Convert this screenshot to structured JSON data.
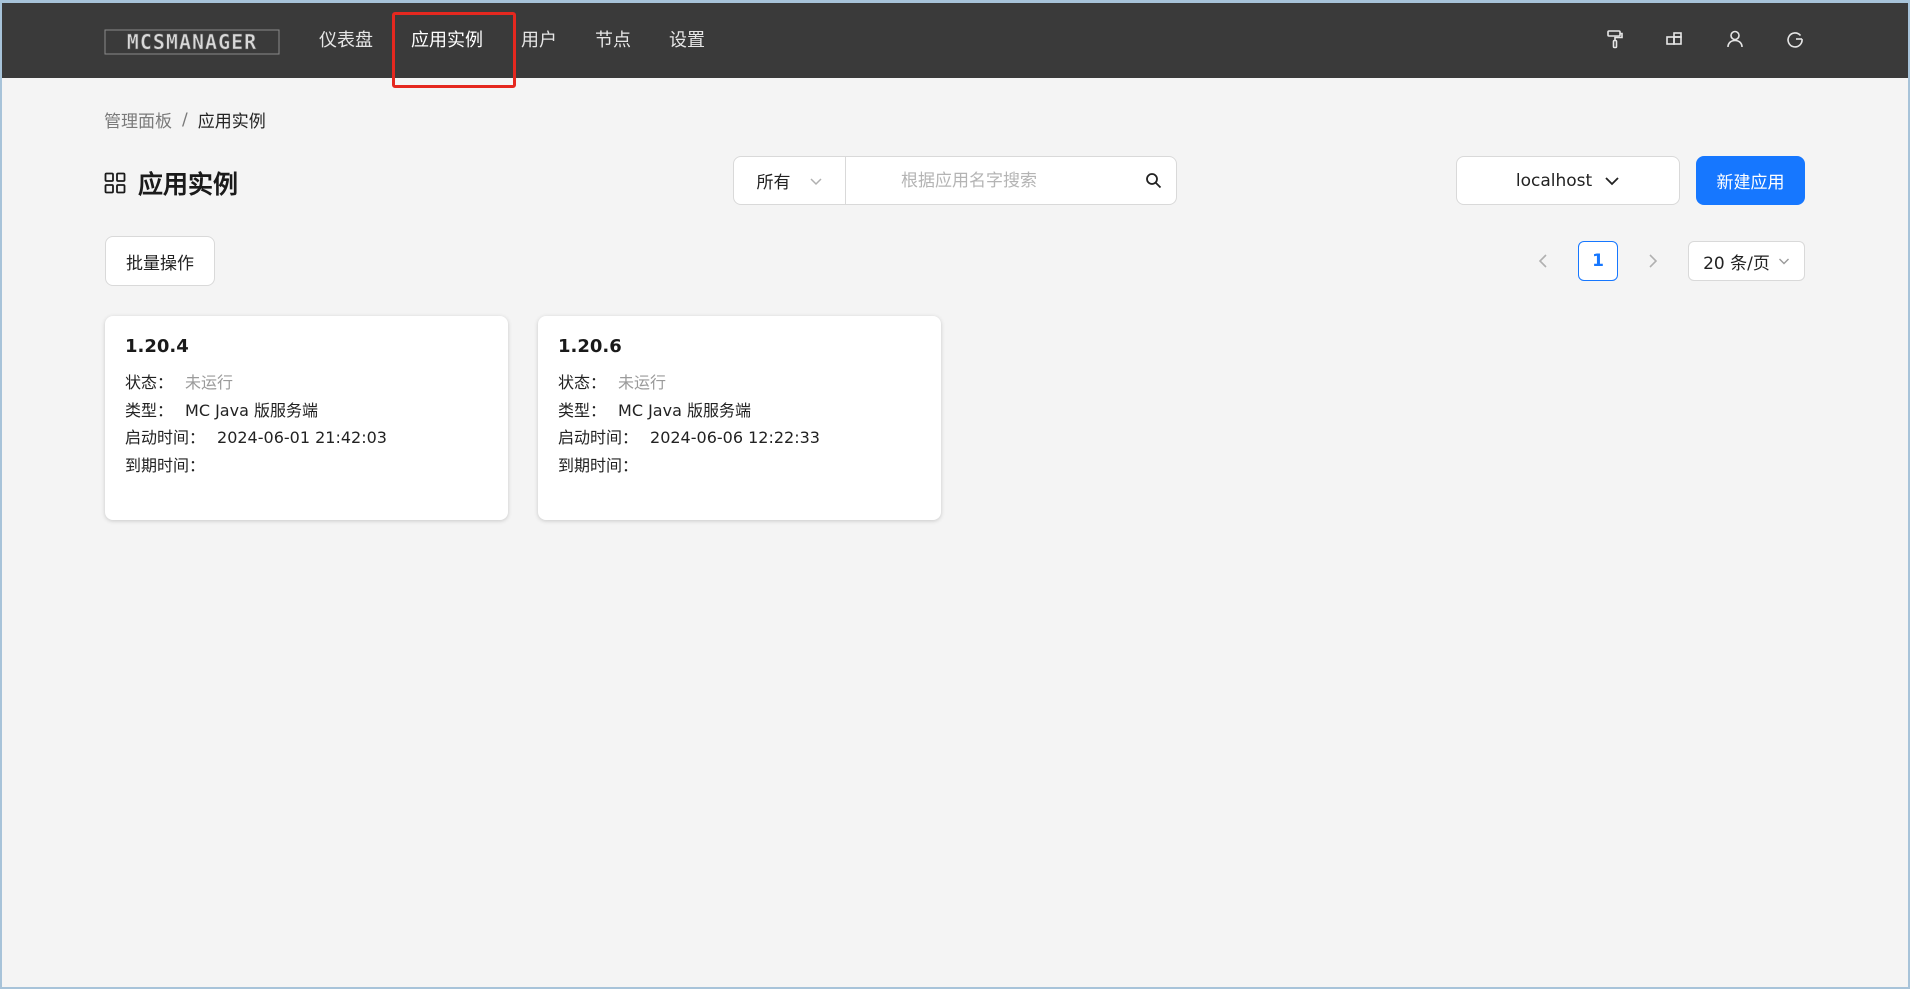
{
  "app": {
    "logo_text": "MCSMANAGER"
  },
  "nav": {
    "items": [
      {
        "label": "仪表盘"
      },
      {
        "label": "应用实例"
      },
      {
        "label": "用户"
      },
      {
        "label": "节点"
      },
      {
        "label": "设置"
      }
    ],
    "active_index": 1
  },
  "top_icons": [
    "paint-roller-icon",
    "layout-icon",
    "user-icon",
    "logout-icon"
  ],
  "breadcrumb": {
    "parent": "管理面板",
    "separator": "/",
    "current": "应用实例"
  },
  "page": {
    "title": "应用实例",
    "title_icon": "grid-icon"
  },
  "filter": {
    "status_value": "所有",
    "search_placeholder": "根据应用名字搜索"
  },
  "node_select": {
    "value": "localhost"
  },
  "buttons": {
    "new_app": "新建应用",
    "batch": "批量操作"
  },
  "pagination": {
    "current_page": "1",
    "page_size": "20 条/页"
  },
  "instances": [
    {
      "name": "1.20.4",
      "status_label": "状态：",
      "status": "未运行",
      "type_label": "类型：",
      "type": "MC Java 版服务端",
      "start_label": "启动时间：",
      "start_time": "2024-06-01 21:42:03",
      "expire_label": "到期时间：",
      "expire_time": ""
    },
    {
      "name": "1.20.6",
      "status_label": "状态：",
      "status": "未运行",
      "type_label": "类型：",
      "type": "MC Java 版服务端",
      "start_label": "启动时间：",
      "start_time": "2024-06-06 12:22:33",
      "expire_label": "到期时间：",
      "expire_time": ""
    }
  ],
  "colors": {
    "primary": "#1677ff",
    "topbar": "#3a3a3a",
    "highlight": "#e5281f"
  }
}
